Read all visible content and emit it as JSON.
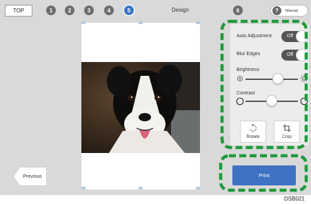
{
  "header": {
    "top_label": "TOP",
    "steps": [
      "1",
      "2",
      "3",
      "4",
      "5"
    ],
    "current_step_title": "Design",
    "next_step": "6",
    "manual_icon": "?",
    "manual_label": "Manual"
  },
  "settings": {
    "auto_adjustment": {
      "label": "Auto Adjustment",
      "state": "Off"
    },
    "blur_edges": {
      "label": "Blur Edges",
      "state": "Off"
    },
    "brightness": {
      "label": "Brightness",
      "level": 0.62
    },
    "contrast": {
      "label": "Contrast",
      "level": 0.5
    },
    "rotate_label": "Rotate",
    "crop_label": "Crop"
  },
  "navigation": {
    "previous_label": "Previous"
  },
  "print_label": "Print",
  "figure_code": "DSB021",
  "colors": {
    "accent": "#3f72c2",
    "highlight_dash": "#1f9a3a",
    "toggle_off": "#555555",
    "background": "#d9d9d9"
  },
  "icons": {
    "brightness_low": "sun-small-icon",
    "brightness_high": "sun-large-icon",
    "contrast_low": "circle-outline-icon",
    "contrast_high": "circle-outline-icon",
    "rotate": "rotate-icon",
    "crop": "crop-icon"
  }
}
